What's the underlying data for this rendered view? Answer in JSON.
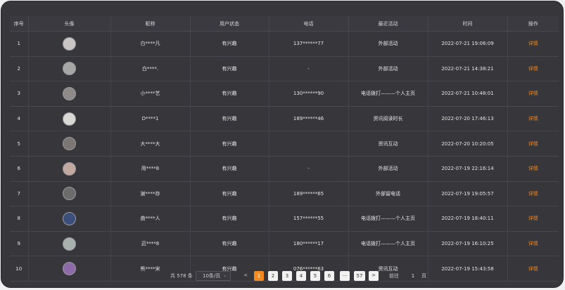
{
  "columns": [
    "序号",
    "头像",
    "昵称",
    "用户状态",
    "电话",
    "最近活动",
    "时间",
    "操作"
  ],
  "rows": [
    {
      "no": "1",
      "avatar_color": "#c9c5c4",
      "nick": "白****凡",
      "status": "有兴趣",
      "phone": "137******77",
      "activity": "外部活动",
      "time": "2022-07-21 19:06:09",
      "op": "详情"
    },
    {
      "no": "2",
      "avatar_color": "#a7a6a6",
      "nick": "白****.",
      "status": "有兴趣",
      "phone": "-",
      "activity": "外部活动",
      "time": "2022-07-21 14:38:21",
      "op": "详情"
    },
    {
      "no": "3",
      "avatar_color": "#8d8a88",
      "nick": "小****艺",
      "status": "有兴趣",
      "phone": "130******90",
      "activity": "电话拨打———个人主页",
      "time": "2022-07-21 10:48:01",
      "op": "详情"
    },
    {
      "no": "4",
      "avatar_color": "#d9d8d4",
      "nick": "D****1",
      "status": "有兴趣",
      "phone": "189******46",
      "activity": "资讯阅读时长",
      "time": "2022-07-20 17:46:13",
      "op": "详情"
    },
    {
      "no": "5",
      "avatar_color": "#7b7673",
      "nick": "大****大",
      "status": "有兴趣",
      "phone": "",
      "activity": "资讯互动",
      "time": "2022-07-20 10:20:05",
      "op": "详情"
    },
    {
      "no": "6",
      "avatar_color": "#c1a9a0",
      "nick": "用****8",
      "status": "有兴趣",
      "phone": "-",
      "activity": "外部活动",
      "time": "2022-07-19 22:16:14",
      "op": "详情"
    },
    {
      "no": "7",
      "avatar_color": "#6d6c6d",
      "nick": "谢****存",
      "status": "有兴趣",
      "phone": "189******65",
      "activity": "外部留电话",
      "time": "2022-07-19 19:05:57",
      "op": "详情"
    },
    {
      "no": "8",
      "avatar_color": "#3b4f7a",
      "nick": "曲****人",
      "status": "有兴趣",
      "phone": "157******55",
      "activity": "电话拨打———个人主页",
      "time": "2022-07-19 18:40:11",
      "op": "详情"
    },
    {
      "no": "9",
      "avatar_color": "#a8b1ad",
      "nick": "迈****8",
      "status": "有兴趣",
      "phone": "180******17",
      "activity": "电话拨打———个人主页",
      "time": "2022-07-19 16:10:25",
      "op": "详情"
    },
    {
      "no": "10",
      "avatar_color": "#8d6aa8",
      "nick": "熊****宋",
      "status": "有兴趣",
      "phone": "076******63",
      "activity": "资讯互动",
      "time": "2022-07-19 15:43:58",
      "op": "详情"
    }
  ],
  "pagination": {
    "total": "共 578 条",
    "page_size": "10条/页",
    "prev": "<",
    "pages": [
      "1",
      "2",
      "3",
      "4",
      "5",
      "6",
      "···",
      "57"
    ],
    "next": ">",
    "goto_label": "前往",
    "goto_value": "1",
    "page_label": "页"
  },
  "colors": {
    "accent": "#f28a1f",
    "background": "#37363b"
  }
}
